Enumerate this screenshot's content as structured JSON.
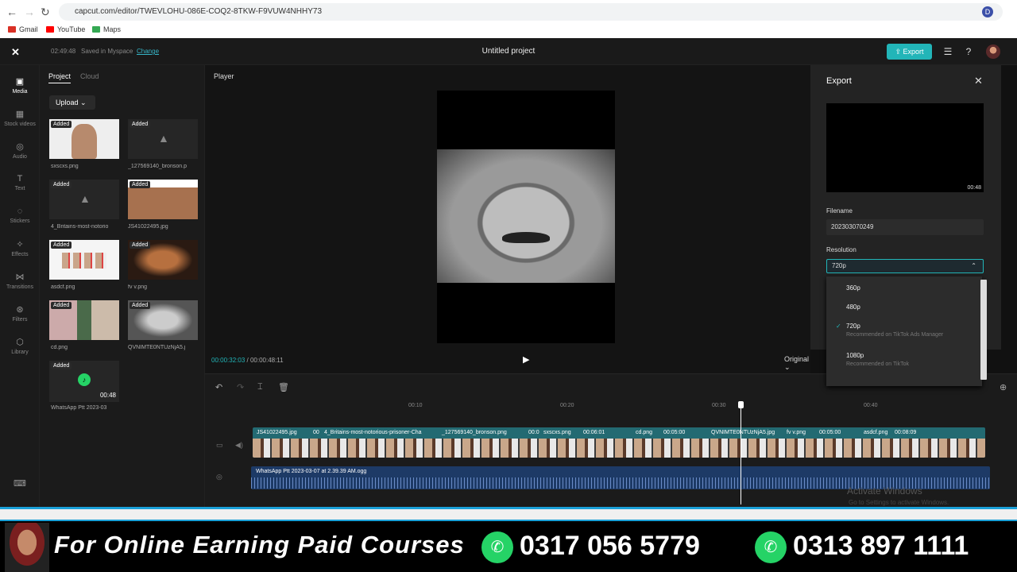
{
  "browser": {
    "url": "capcut.com/editor/TWEVLOHU-086E-COQ2-8TKW-F9VUW4NHHY73",
    "bookmarks": [
      "Gmail",
      "YouTube",
      "Maps"
    ],
    "profile_initial": "D"
  },
  "app": {
    "save_time": "02:49:48",
    "saved_in": "Saved in Myspace",
    "change_link": "Change",
    "project_title": "Untitled project",
    "export_button": "Export"
  },
  "rail": [
    "Media",
    "Stock videos",
    "Audio",
    "Text",
    "Stickers",
    "Effects",
    "Transitions",
    "Filters",
    "Library"
  ],
  "media": {
    "tabs": [
      "Project",
      "Cloud"
    ],
    "upload_label": "Upload",
    "added_badge": "Added",
    "audio_duration": "00:48",
    "items": [
      "sxscxs.png",
      "_127569140_bronson.p",
      "4_Britains-most-notorio",
      "JS41022495.jpg",
      "asdcf.png",
      "fv v.png",
      "cd.png",
      "QVNIMTE0NTUzNjA5.j",
      "WhatsApp Ptt 2023-03"
    ]
  },
  "player": {
    "label": "Player",
    "current_time": "00:00:32:03",
    "total_time": "/ 00:00:48:11",
    "ratio": "Original"
  },
  "export": {
    "title": "Export",
    "preview_duration": "00:48",
    "filename_label": "Filename",
    "filename_value": "202303070249",
    "resolution_label": "Resolution",
    "resolution_value": "720p",
    "options": [
      {
        "label": "360p",
        "note": ""
      },
      {
        "label": "480p",
        "note": ""
      },
      {
        "label": "720p",
        "note": "Recommended on TikTok Ads Manager"
      },
      {
        "label": "1080p",
        "note": "Recommended on TikTok"
      }
    ]
  },
  "timeline": {
    "ticks": [
      "00:10",
      "00:20",
      "00:30",
      "00:40"
    ],
    "clips": [
      "JS41022495.jpg",
      "00",
      "4_Britains-most-notorious-prisoner-Cha",
      "_127569140_bronson.png",
      "00:0",
      "sxscxs.png",
      "00:06:01",
      "cd.png",
      "00:05:00",
      "QVNIMTE0NTUzNjA5.jpg",
      "fv v.png",
      "00:05:00",
      "asdcf.png",
      "00:08:09"
    ],
    "audio_clip": "WhatsApp Ptt 2023-03-07 at 2.39.39 AM.ogg",
    "watermark_title": "Activate Windows",
    "watermark_sub": "Go to Settings to activate Windows."
  },
  "banner": {
    "text": "For Online Earning Paid Courses",
    "phone1": "0317 056 5779",
    "phone2": "0313 897 1111"
  },
  "colors": {
    "accent": "#22b5b8",
    "whatsapp": "#25d366"
  }
}
